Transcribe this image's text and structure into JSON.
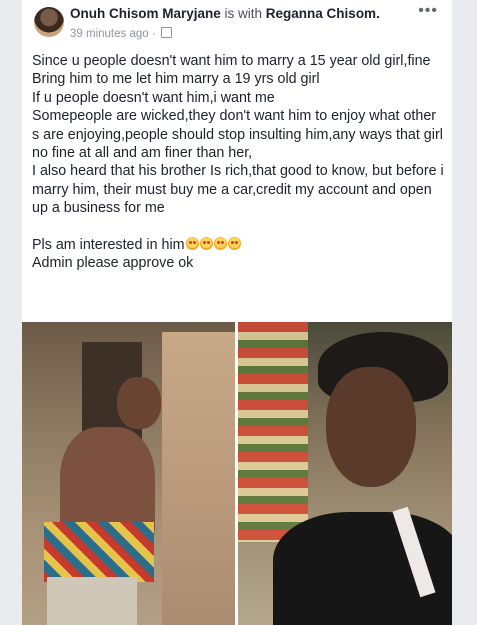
{
  "post": {
    "author": "Onuh Chisom Maryjane",
    "with_text": " is with ",
    "tagged": "Reganna Chisom.",
    "time": "39 minutes ago ·",
    "more": "•••",
    "lines": [
      "Since u people doesn't want him to marry a 15 year old girl,fine",
      "Bring him to me let him marry a 19 yrs old girl",
      "If u people doesn't want him,i want me",
      "Somepeople are wicked,they don't want him to enjoy what other s are enjoying,people should stop insulting him,any ways that girl no fine at all and am finer than her,",
      "I also heard that his brother Is rich,that good to know, but before i marry him, their must buy me a car,credit my account and open up a business for me"
    ],
    "closing_1": "Pls am interested in him",
    "closing_2": "Admin please approve ok",
    "emoji_count": 4
  },
  "icons": {
    "avatar": "profile-photo",
    "privacy": "globe-icon",
    "more": "more-options-icon",
    "emoji": "heart-eyes-emoji"
  }
}
